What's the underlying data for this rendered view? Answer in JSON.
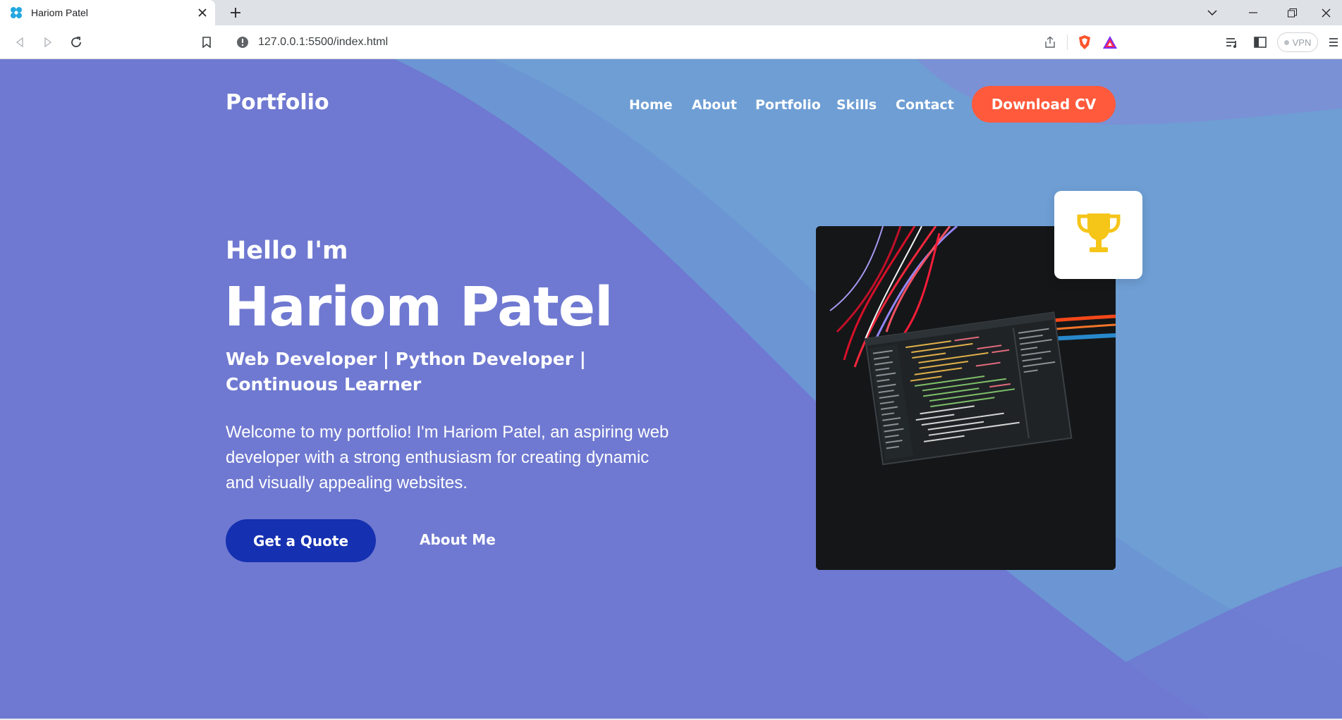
{
  "browser": {
    "tab_title": "Hariom Patel",
    "url": "127.0.0.1:5500/index.html",
    "vpn_label": "VPN"
  },
  "colors": {
    "page_bg": "#6f79d1",
    "accent_button": "#ff5a3c",
    "primary_button": "#1530b0",
    "trophy": "#f5c518"
  },
  "site": {
    "brand": "Portfolio",
    "nav": [
      "Home",
      "About",
      "Portfolio",
      "Skills",
      "Contact"
    ],
    "cta": "Download CV"
  },
  "hero": {
    "greeting": "Hello I'm",
    "name": "Hariom Patel",
    "roles": "Web Developer | Python Developer | Continuous Learner",
    "intro": "Welcome to my portfolio! I'm Hariom Patel, an aspiring web developer with a strong enthusiasm for creating dynamic and visually appealing websites.",
    "primary_button": "Get a Quote",
    "secondary_button": "About Me"
  },
  "icons": [
    "favicon-icon",
    "close-icon",
    "plus-icon",
    "back-icon",
    "forward-icon",
    "reload-icon",
    "bookmark-icon",
    "info-icon",
    "share-icon",
    "brave-shield-icon",
    "brave-rewards-icon",
    "playlist-icon",
    "sidebar-icon",
    "menu-icon",
    "trophy-icon"
  ]
}
